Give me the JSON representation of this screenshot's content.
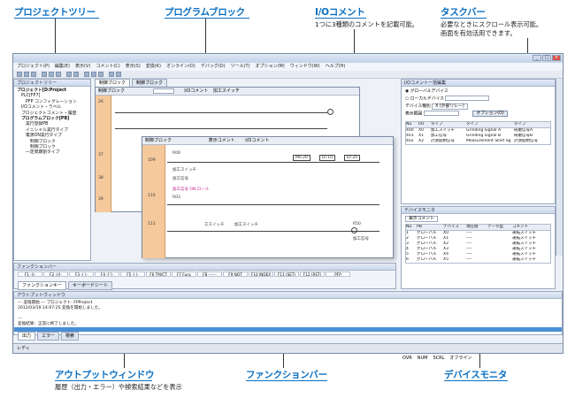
{
  "callouts": {
    "project_tree": "プロジェクトツリー",
    "program_block": "プログラムブロック",
    "io_comment": "I/Oコメント",
    "io_comment_desc": "1つに3種類のコメントを記載可能。",
    "taskbar": "タスクバー",
    "taskbar_desc1": "必要なときにスクロール表示可能。",
    "taskbar_desc2": "画面を有効活用できます。",
    "output_window": "アウトプットウィンドウ",
    "output_window_desc": "履歴（出力・エラー）や検索結果などを表示",
    "function_bar": "ファンクションバー",
    "device_monitor": "デバイスモニタ"
  },
  "app": {
    "menu": [
      "プロジェクト(P)",
      "編集(E)",
      "表示(V)",
      "コメント(C)",
      "表示(S)",
      "変換(K)",
      "オンライン(O)",
      "デバッグ(D)",
      "ツール(T)",
      "オプション(M)",
      "ウィンドウ(W)",
      "ヘルプ(H)"
    ],
    "tree_panel_title": "プロジェクトツリー",
    "tree": [
      "プロジェクト[D:Project",
      "PLC[FP7]",
      "PFP コンフィグレーション",
      "I/Oコメント・ラベル",
      "プロジェクトコメント・履歴",
      "プログラムブロック[PB]",
      "実行登録PB",
      "イニシャル実行タイプ",
      "電源ON実行タイプ",
      "制御ブロック",
      "制御プロック",
      "一定周期割タイプ"
    ],
    "tabs": [
      "制御ブロック",
      "制御ブロック"
    ],
    "ladder_back_title": "制御ブロック",
    "ladder_front_title": "制御ブロック",
    "comment_select": "表示コメント",
    "io_comment_label": "I/Oコメント",
    "io_comment_value": "加工スイッチ",
    "rung_numbers": [
      "26",
      "37",
      "38",
      "39"
    ],
    "front_rungs": [
      "109",
      "110",
      "111"
    ],
    "contact_labels": [
      "R00",
      "加工スイッチ",
      "加工信号",
      "R03",
      "工スイッチ",
      "加工スイッチ",
      "R50",
      "加工信号"
    ],
    "magenta_comment": "加工信号 ON ロール",
    "box_labels": [
      "M0.20",
      "DT10",
      "DT20"
    ],
    "io_panel_title": "I/Oコメント一括編集",
    "io_radio1": "グローバルデバイス",
    "io_radio2": "ローカルデバイス",
    "device_type_label": "デバイス種別",
    "device_type_value": "X (外部リレー)",
    "display_range_label": "表示範囲",
    "option_button": "オプション(O)",
    "io_table_headers": [
      "No.",
      "I/O",
      "タイプ",
      "タイプ",
      "タイプ"
    ],
    "io_table_rows": [
      [
        "400",
        "X0",
        "加工スイッチ",
        "Grinding Signal A",
        "研磨信号A"
      ],
      [
        "401",
        "X1",
        "加工信号",
        "Grinding Signal B",
        "研磨信号B"
      ],
      [
        "402",
        "X2",
        "計測開始信号",
        "Measurement Start Sg",
        "計測開始信号"
      ]
    ],
    "device_panel_title": "デバイスモニタ",
    "device_select": "表示コメント",
    "device_table_headers": [
      "No.",
      "PB",
      "デバイス",
      "現在値",
      "データ型",
      "コメント"
    ],
    "device_table_rows": [
      [
        "1",
        "グローバル",
        "X0",
        "----",
        "",
        "運転スイッチ"
      ],
      [
        "2",
        "グローバル",
        "X1",
        "----",
        "",
        "運転スイッチ"
      ],
      [
        "3",
        "グローバル",
        "X2",
        "----",
        "",
        "運転スイッチ"
      ],
      [
        "4",
        "グローバル",
        "X3",
        "----",
        "",
        "運転スイッチ"
      ],
      [
        "5",
        "グローバル",
        "X4",
        "----",
        "",
        "運転スイッチ"
      ],
      [
        "6",
        "グローバル",
        "X5",
        "----",
        "",
        "運転スイッチ"
      ]
    ],
    "function_bar_title": "ファンクションバー",
    "function_keys": [
      "F1 -||-",
      "F2 -|/|-",
      "F3 -( )-",
      "F4 -[ ]-",
      "F5 -| |-",
      "F6 TM/CT",
      "F7 Func",
      "F8 ------",
      "F9 NOT",
      "F10 INDEX",
      "F11 (SET)",
      "F12 (RST)",
      "PFP"
    ],
    "function_tabs": [
      "ファンクションキー",
      "キーボードシート"
    ],
    "output_title": "アウトプットウィンドウ",
    "output_lines": [
      "--- 変換開始 --- プロジェクト: FPProject",
      "2012/03/19 14:07:25 変換を開始しました。",
      "",
      "---",
      "変換結果：正常に終了しました。"
    ],
    "output_tabs": [
      "出力",
      "エラー",
      "検索"
    ],
    "status_left": "レディ",
    "status_right": [
      "OVR",
      "NUM",
      "SCRL",
      "オフライン"
    ]
  }
}
